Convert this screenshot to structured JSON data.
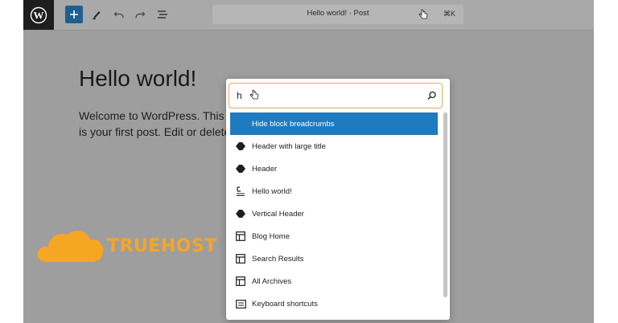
{
  "toolbar": {
    "command_title": "Hello world! · Post",
    "shortcut": "⌘K",
    "icons": [
      "wordpress-icon",
      "plus-icon",
      "pen-icon",
      "undo-icon",
      "redo-icon",
      "list-view-icon"
    ]
  },
  "post": {
    "title": "Hello world!",
    "body": "Welcome to WordPress. This is your first post. Edit or delete it, then start writing!"
  },
  "brand": {
    "name": "TRUEHOST",
    "color": "#f5a623"
  },
  "palette": {
    "search_value": "h",
    "items": [
      {
        "label": "Hide block breadcrumbs",
        "icon": "none"
      },
      {
        "label": "Header with large title",
        "icon": "diamond-icon"
      },
      {
        "label": "Header",
        "icon": "diamond-icon"
      },
      {
        "label": "Hello world!",
        "icon": "post-icon"
      },
      {
        "label": "Vertical Header",
        "icon": "diamond-icon"
      },
      {
        "label": "Blog Home",
        "icon": "layout-icon"
      },
      {
        "label": "Search Results",
        "icon": "layout-icon"
      },
      {
        "label": "All Archives",
        "icon": "layout-icon"
      },
      {
        "label": "Keyboard shortcuts",
        "icon": "keyboard-icon"
      }
    ]
  },
  "colors": {
    "accent": "#1f7bbf",
    "search_border": "#f0a35e",
    "overlay": "#9e9e9e"
  }
}
